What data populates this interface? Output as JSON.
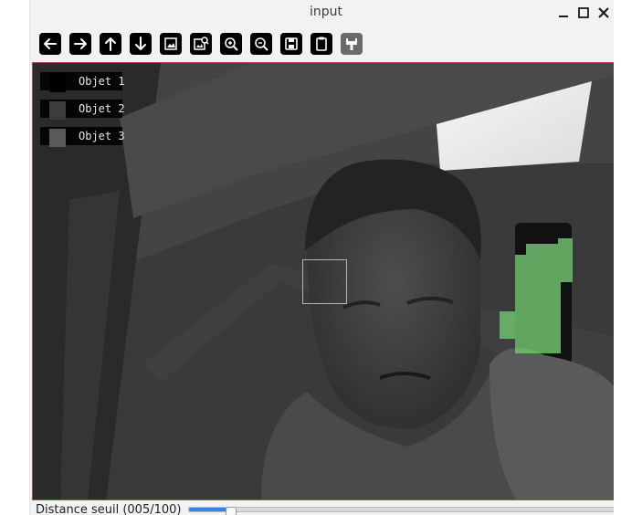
{
  "window": {
    "title": "input",
    "controls": {
      "minimize": "minimize",
      "maximize": "maximize",
      "close": "close"
    }
  },
  "toolbar": {
    "buttons": [
      {
        "icon": "arrow-left-icon",
        "name": "pan-left-button"
      },
      {
        "icon": "arrow-right-icon",
        "name": "pan-right-button"
      },
      {
        "icon": "arrow-up-icon",
        "name": "pan-up-button"
      },
      {
        "icon": "arrow-down-icon",
        "name": "pan-down-button"
      },
      {
        "icon": "image-icon",
        "name": "zoom-fit-button"
      },
      {
        "icon": "image-search-icon",
        "name": "zoom-original-button"
      },
      {
        "icon": "zoom-in-icon",
        "name": "zoom-in-button"
      },
      {
        "icon": "zoom-out-icon",
        "name": "zoom-out-button"
      },
      {
        "icon": "save-icon",
        "name": "save-image-button"
      },
      {
        "icon": "clipboard-icon",
        "name": "copy-clipboard-button"
      },
      {
        "icon": "properties-icon",
        "name": "properties-button"
      }
    ]
  },
  "overlay": {
    "legend": [
      {
        "label": "Objet 1",
        "color": "#000000"
      },
      {
        "label": "Objet 2",
        "color": "#3c3c3c"
      },
      {
        "label": "Objet 3",
        "color": "#5a5a5a"
      }
    ],
    "detection_color": "#6fc16f"
  },
  "slider": {
    "label": "Distance seuil (005/100)",
    "value": 5,
    "max": 100
  },
  "colors": {
    "viewport_border": "#b3494a",
    "slider_accent": "#3584e4"
  }
}
